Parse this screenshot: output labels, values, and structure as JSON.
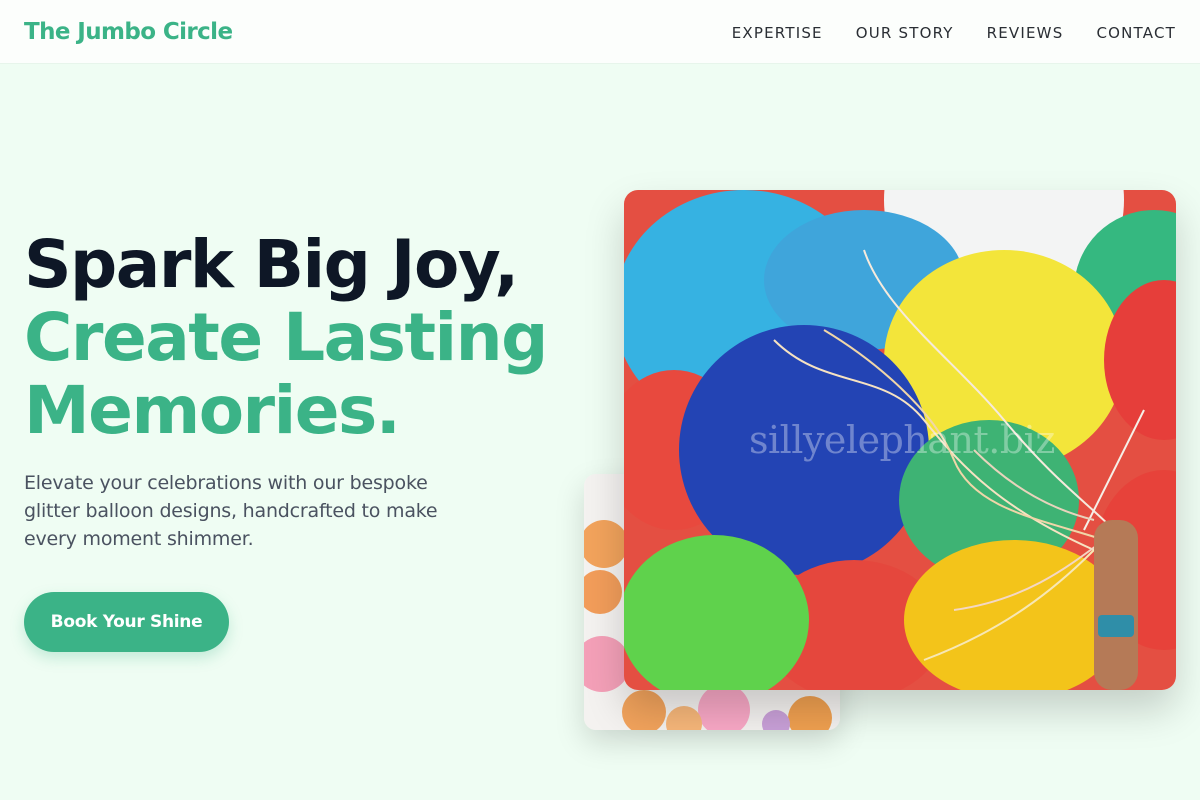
{
  "brand": {
    "name": "The Jumbo Circle"
  },
  "nav": {
    "items": [
      {
        "label": "EXPERTISE"
      },
      {
        "label": "OUR STORY"
      },
      {
        "label": "REVIEWS"
      },
      {
        "label": "CONTACT"
      }
    ]
  },
  "hero": {
    "title_line1": "Spark Big Joy,",
    "title_line2": "Create Lasting",
    "title_line3": "Memories.",
    "description": "Elevate your celebrations with our bespoke glitter balloon designs, handcrafted to make every moment shimmer.",
    "cta_label": "Book Your Shine"
  },
  "images": {
    "main_watermark": "sillyelephant.biz"
  },
  "colors": {
    "accent": "#3bb387",
    "heading_dark": "#0e1726",
    "background": "#effdf3",
    "nav_background": "#fcfefc",
    "body_text": "#4a5260"
  }
}
